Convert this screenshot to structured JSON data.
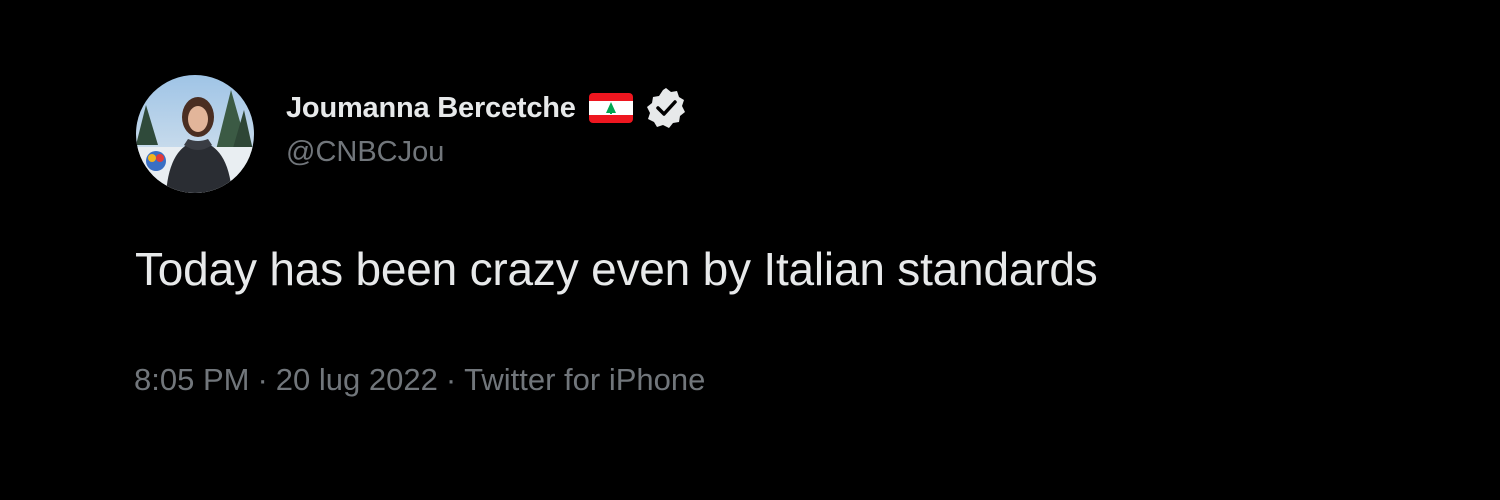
{
  "tweet": {
    "author": {
      "display_name": "Joumanna Bercetche",
      "handle": "@CNBCJou",
      "flag_icon": "lebanon-flag-icon",
      "verified_icon": "verified-badge-icon",
      "avatar": "profile-photo"
    },
    "text": "Today has been crazy even by Italian standards",
    "meta": {
      "time": "8:05 PM",
      "separator": "·",
      "date": "20 lug 2022",
      "source": "Twitter for iPhone"
    }
  },
  "colors": {
    "background": "#000000",
    "primary_text": "#e7e9ea",
    "secondary_text": "#71767b",
    "flag_red": "#ee161f",
    "flag_green": "#00a651"
  }
}
